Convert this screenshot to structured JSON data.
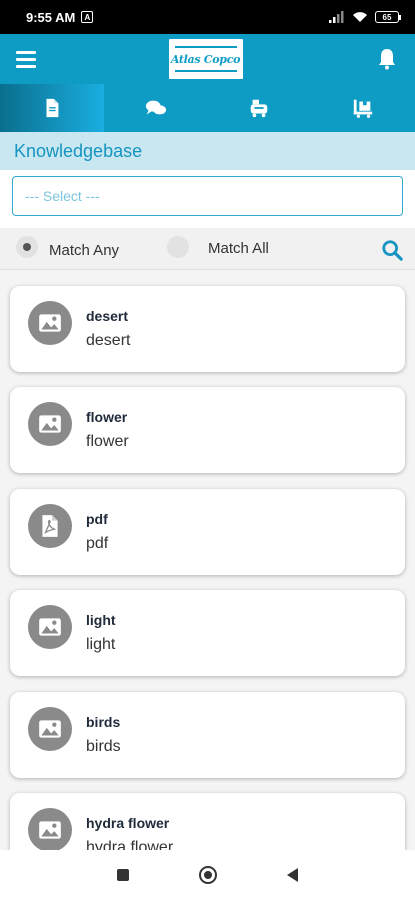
{
  "status_bar": {
    "time": "9:55 AM",
    "notification_badge": "A",
    "battery_level": "65"
  },
  "app_bar": {
    "logo_text": "Atlas Copco",
    "menu_icon": "hamburger-icon",
    "notification_icon": "bell-icon"
  },
  "tabs": [
    {
      "icon": "document-icon",
      "active": true
    },
    {
      "icon": "chat-icon",
      "active": false
    },
    {
      "icon": "compressor-icon",
      "active": false
    },
    {
      "icon": "cart-icon",
      "active": false
    }
  ],
  "section": {
    "title": "Knowledgebase"
  },
  "select": {
    "value": "--- Select ---"
  },
  "match": {
    "any_label": "Match Any",
    "all_label": "Match All",
    "selected": "any"
  },
  "list": {
    "items": [
      {
        "title": "desert",
        "subtitle": "desert",
        "icon": "image-icon"
      },
      {
        "title": "flower",
        "subtitle": "flower",
        "icon": "image-icon"
      },
      {
        "title": "pdf",
        "subtitle": "pdf",
        "icon": "pdf-icon"
      },
      {
        "title": "light",
        "subtitle": "light",
        "icon": "image-icon"
      },
      {
        "title": "birds",
        "subtitle": "birds",
        "icon": "image-icon"
      },
      {
        "title": "hydra flower",
        "subtitle": "hydra flower",
        "icon": "image-icon"
      }
    ]
  },
  "colors": {
    "primary": "#0f9cc4",
    "header_bg": "#c8e7f1",
    "accent_text": "#1595c0"
  }
}
